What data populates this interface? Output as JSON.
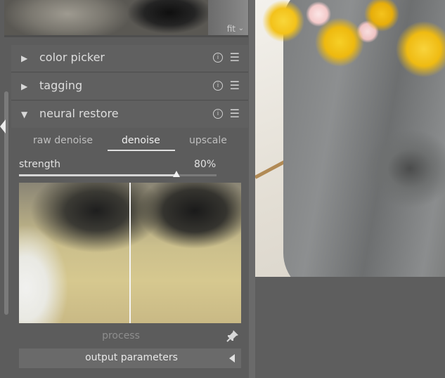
{
  "thumbnail": {
    "zoom_label": "fit",
    "zoom_caret": "⌄"
  },
  "modules": [
    {
      "label": "color picker",
      "expanded": false,
      "arrow": "▶",
      "info_icon": "ⓘ",
      "menu_icon": "☰"
    },
    {
      "label": "tagging",
      "expanded": false,
      "arrow": "▶",
      "info_icon": "ⓘ",
      "menu_icon": "☰"
    },
    {
      "label": "neural restore",
      "expanded": true,
      "arrow": "▼",
      "info_icon": "ⓘ",
      "menu_icon": "☰"
    }
  ],
  "neural_restore": {
    "tabs": [
      {
        "label": "raw denoise",
        "active": false
      },
      {
        "label": "denoise",
        "active": true
      },
      {
        "label": "upscale",
        "active": false
      }
    ],
    "strength": {
      "label": "strength",
      "value_text": "80%",
      "value": 0.8
    },
    "process_label": "process",
    "output_parameters_label": "output parameters"
  },
  "colors": {
    "panel_bg": "#5c5c5c",
    "accent_text": "#e0e0e0"
  },
  "icons": {
    "pin": "pin-icon",
    "collapse": "collapse-panel-icon"
  }
}
